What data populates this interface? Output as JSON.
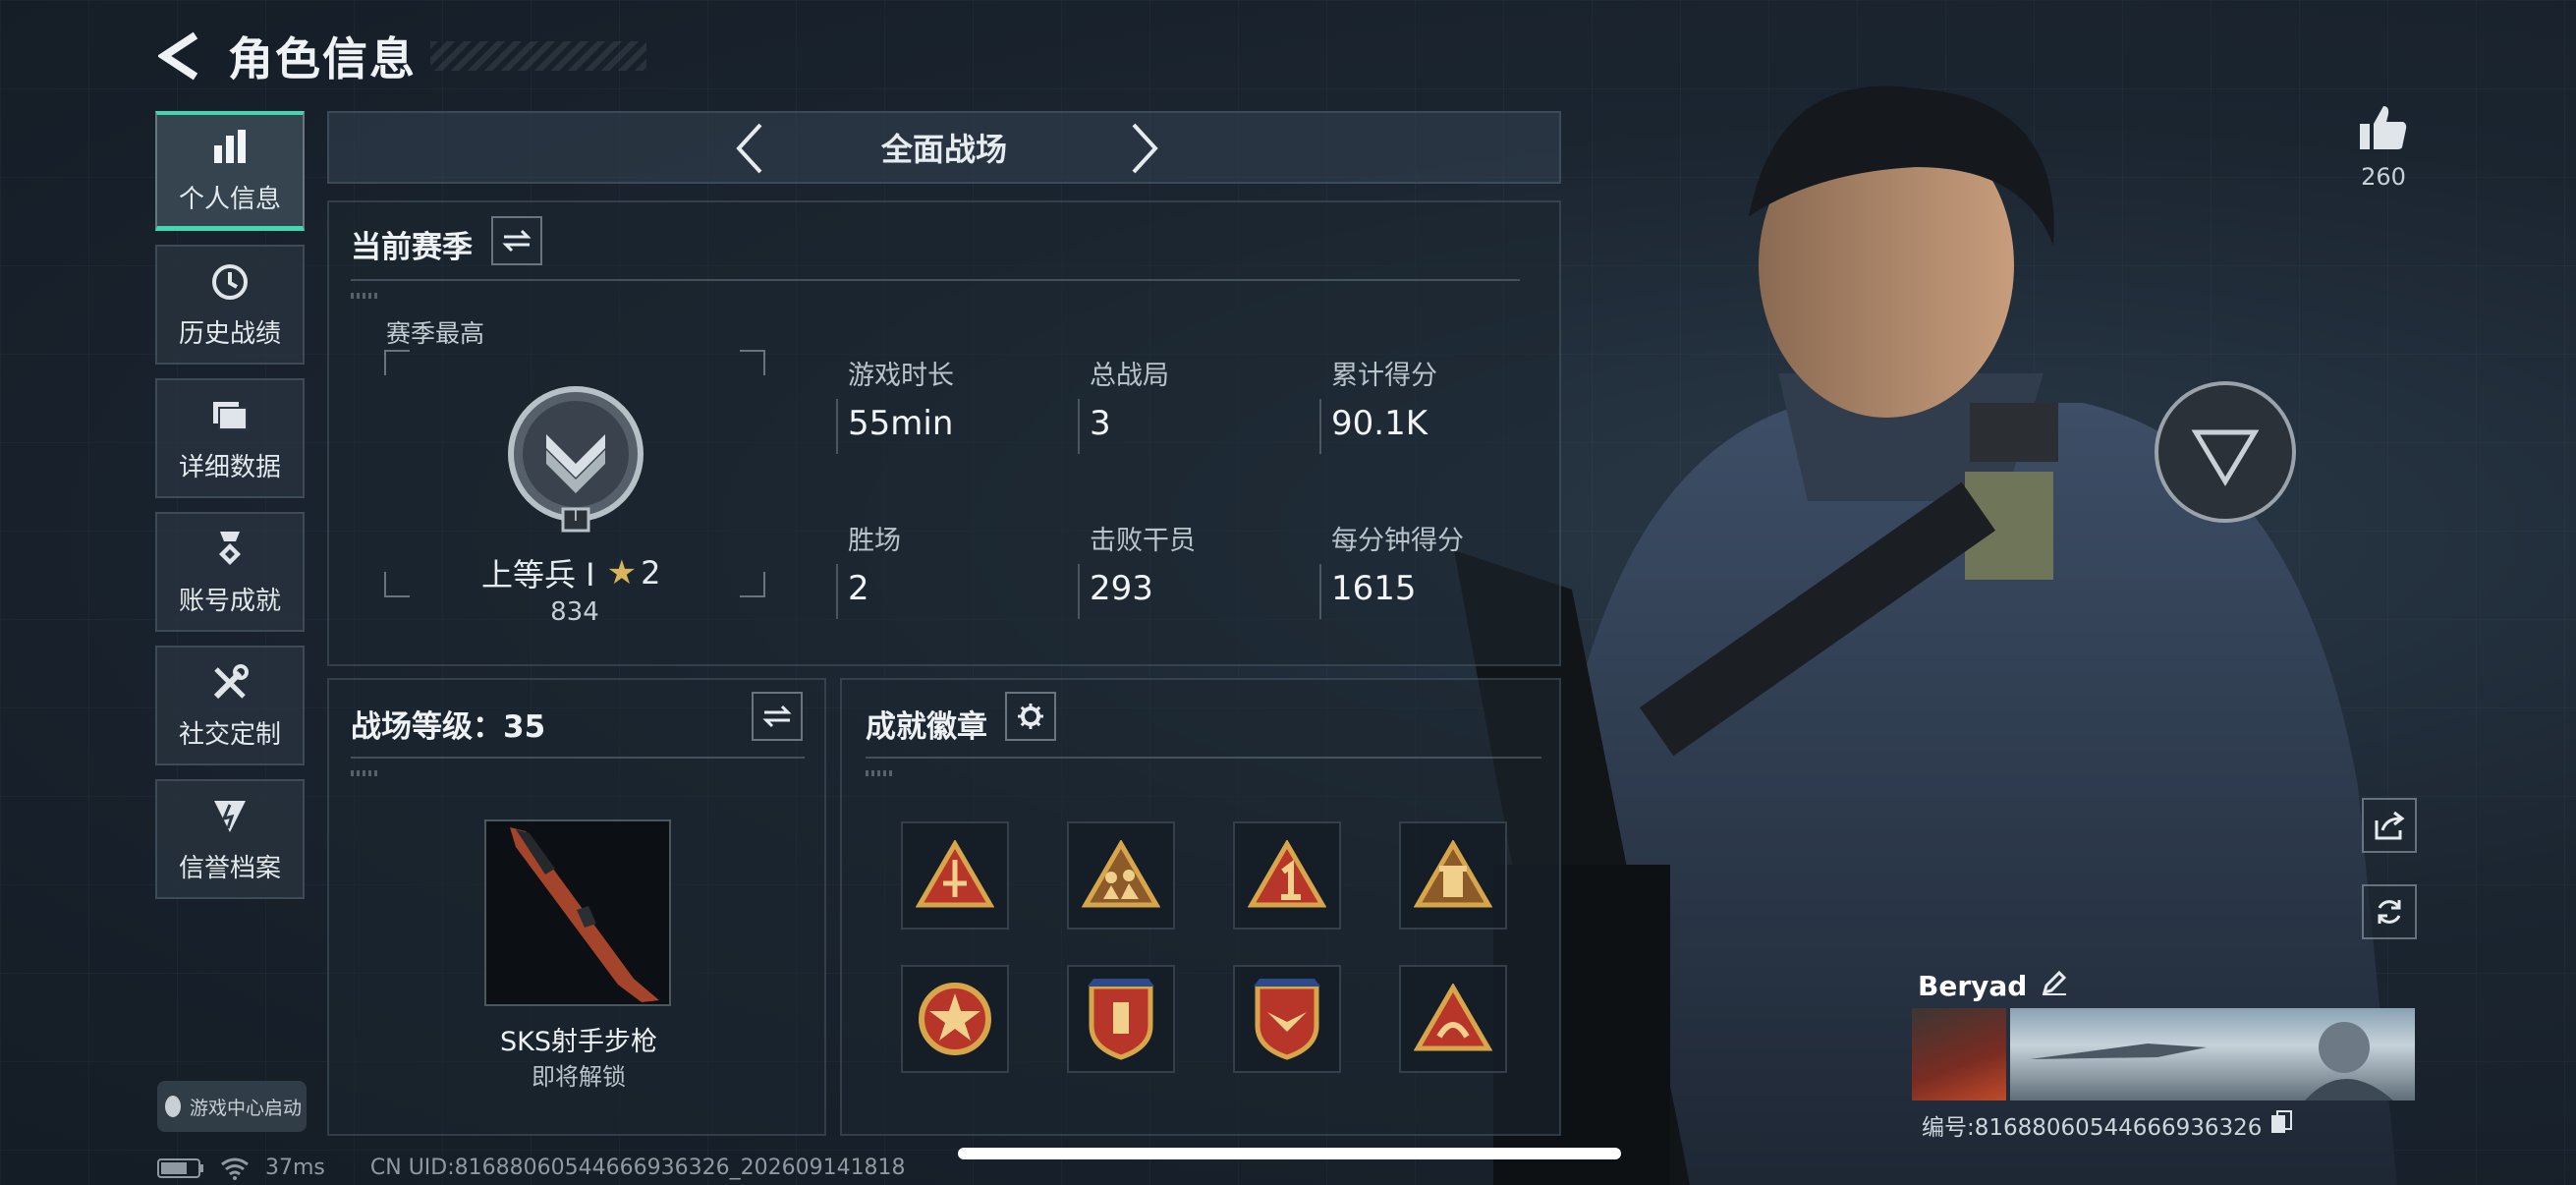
{
  "header": {
    "title": "角色信息"
  },
  "nav": [
    {
      "label": "个人信息",
      "icon": "bar-chart-icon",
      "active": true
    },
    {
      "label": "历史战绩",
      "icon": "clock-icon"
    },
    {
      "label": "详细数据",
      "icon": "folder-icon"
    },
    {
      "label": "账号成就",
      "icon": "medal-icon"
    },
    {
      "label": "社交定制",
      "icon": "tools-icon"
    },
    {
      "label": "信誉档案",
      "icon": "shield-icon"
    }
  ],
  "game_center": {
    "label": "游戏中心启动"
  },
  "mode": {
    "label": "全面战场"
  },
  "season": {
    "title": "当前赛季",
    "best_label": "赛季最高",
    "rank_name": "上等兵 I",
    "rank_stars": "2",
    "rank_points": "834",
    "rank_tier": "I",
    "stats": [
      {
        "label": "游戏时长",
        "value": "55min"
      },
      {
        "label": "总战局",
        "value": "3"
      },
      {
        "label": "累计得分",
        "value": "90.1K"
      },
      {
        "label": "胜场",
        "value": "2"
      },
      {
        "label": "击败干员",
        "value": "293"
      },
      {
        "label": "每分钟得分",
        "value": "1615"
      }
    ]
  },
  "battle_level": {
    "title": "战场等级：35",
    "weapon_name": "SKS射手步枪",
    "weapon_status": "即将解锁"
  },
  "achievements": {
    "title": "成就徽章",
    "badges": [
      {
        "icon": "triangle-crest-icon"
      },
      {
        "icon": "triangle-soldiers-icon"
      },
      {
        "icon": "triangle-one-icon"
      },
      {
        "icon": "triangle-tower-icon"
      },
      {
        "icon": "round-star-badge-icon"
      },
      {
        "icon": "shield-crest-badge-icon"
      },
      {
        "icon": "shield-wings-badge-icon"
      },
      {
        "icon": "triangle-hands-icon"
      }
    ]
  },
  "profile": {
    "likes": "260",
    "player_name": "Beryad",
    "uid_label": "编号:81688060544666936326"
  },
  "footer": {
    "latency": "37ms",
    "cn_uid": "CN UID:81688060544666936326_202609141818"
  },
  "colors": {
    "accent": "#3fd8b0",
    "gold": "#d8a64a",
    "badge_red": "#b8352a"
  }
}
